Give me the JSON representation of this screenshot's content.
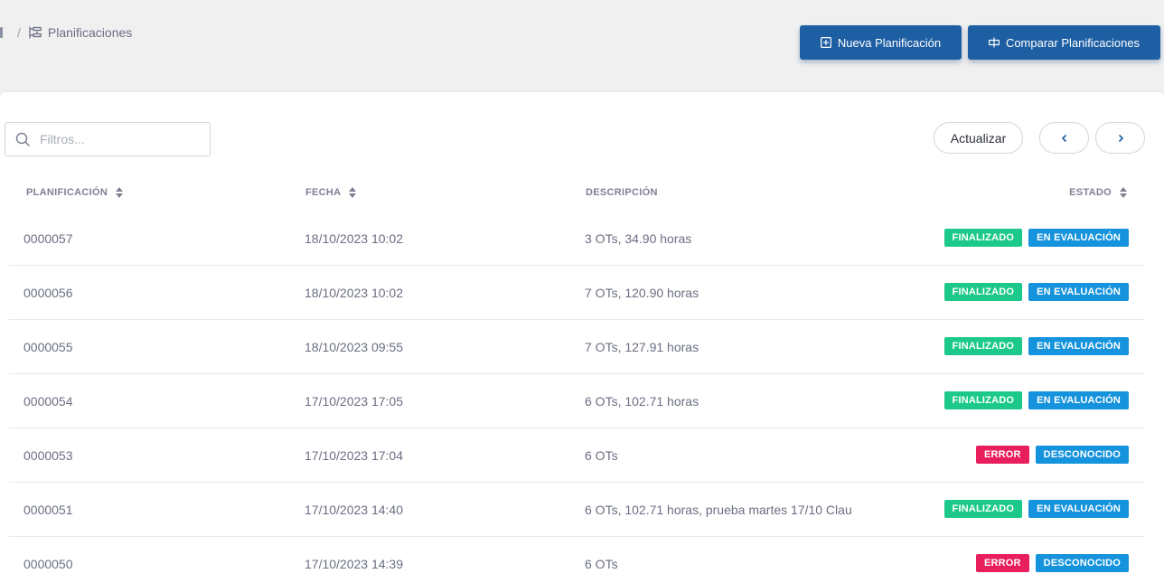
{
  "breadcrumb": {
    "current": "Planificaciones",
    "separator": "/"
  },
  "actions": {
    "new_label": "Nueva Planificación",
    "compare_label": "Comparar Planificaciones"
  },
  "search": {
    "placeholder": "Filtros..."
  },
  "toolbar": {
    "refresh_label": "Actualizar"
  },
  "colors": {
    "primary": "#1e5fa3",
    "finalizado": "#1cc98a",
    "evaluacion": "#1593dc",
    "error": "#e91e5d",
    "desconocido": "#1593dc"
  },
  "table": {
    "headers": {
      "planificacion": "PLANIFICACIÓN",
      "fecha": "FECHA",
      "descripcion": "DESCRIPCIÓN",
      "estado": "ESTADO"
    },
    "rows": [
      {
        "id": "0000057",
        "fecha": "18/10/2023 10:02",
        "descripcion": "3 OTs, 34.90 horas",
        "estado": "FINALIZADO",
        "evaluacion": "EN EVALUACIÓN"
      },
      {
        "id": "0000056",
        "fecha": "18/10/2023 10:02",
        "descripcion": "7 OTs, 120.90 horas",
        "estado": "FINALIZADO",
        "evaluacion": "EN EVALUACIÓN"
      },
      {
        "id": "0000055",
        "fecha": "18/10/2023 09:55",
        "descripcion": "7 OTs, 127.91 horas",
        "estado": "FINALIZADO",
        "evaluacion": "EN EVALUACIÓN"
      },
      {
        "id": "0000054",
        "fecha": "17/10/2023 17:05",
        "descripcion": "6 OTs, 102.71 horas",
        "estado": "FINALIZADO",
        "evaluacion": "EN EVALUACIÓN"
      },
      {
        "id": "0000053",
        "fecha": "17/10/2023 17:04",
        "descripcion": "6 OTs",
        "estado": "ERROR",
        "evaluacion": "DESCONOCIDO"
      },
      {
        "id": "0000051",
        "fecha": "17/10/2023 14:40",
        "descripcion": "6 OTs, 102.71 horas, prueba martes 17/10 Clau",
        "estado": "FINALIZADO",
        "evaluacion": "EN EVALUACIÓN"
      },
      {
        "id": "0000050",
        "fecha": "17/10/2023 14:39",
        "descripcion": "6 OTs",
        "estado": "ERROR",
        "evaluacion": "DESCONOCIDO"
      }
    ]
  }
}
